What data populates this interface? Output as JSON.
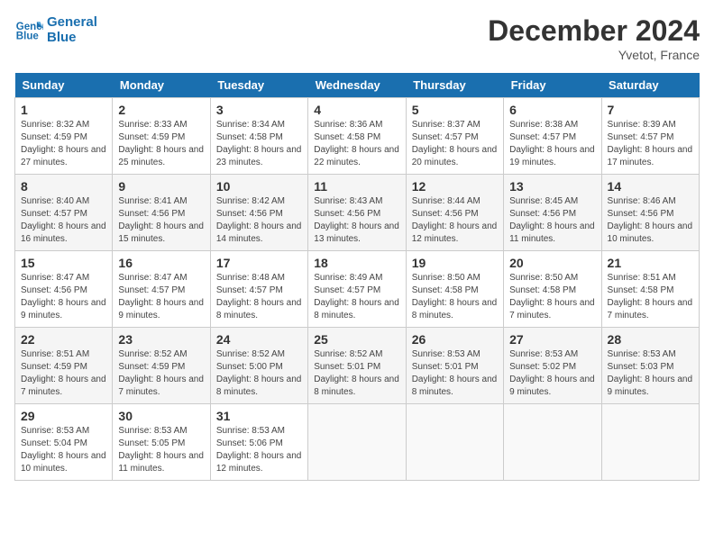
{
  "header": {
    "logo_line1": "General",
    "logo_line2": "Blue",
    "month_title": "December 2024",
    "location": "Yvetot, France"
  },
  "weekdays": [
    "Sunday",
    "Monday",
    "Tuesday",
    "Wednesday",
    "Thursday",
    "Friday",
    "Saturday"
  ],
  "weeks": [
    [
      {
        "day": 1,
        "sunrise": "8:32 AM",
        "sunset": "4:59 PM",
        "daylight": "8 hours and 27 minutes."
      },
      {
        "day": 2,
        "sunrise": "8:33 AM",
        "sunset": "4:59 PM",
        "daylight": "8 hours and 25 minutes."
      },
      {
        "day": 3,
        "sunrise": "8:34 AM",
        "sunset": "4:58 PM",
        "daylight": "8 hours and 23 minutes."
      },
      {
        "day": 4,
        "sunrise": "8:36 AM",
        "sunset": "4:58 PM",
        "daylight": "8 hours and 22 minutes."
      },
      {
        "day": 5,
        "sunrise": "8:37 AM",
        "sunset": "4:57 PM",
        "daylight": "8 hours and 20 minutes."
      },
      {
        "day": 6,
        "sunrise": "8:38 AM",
        "sunset": "4:57 PM",
        "daylight": "8 hours and 19 minutes."
      },
      {
        "day": 7,
        "sunrise": "8:39 AM",
        "sunset": "4:57 PM",
        "daylight": "8 hours and 17 minutes."
      }
    ],
    [
      {
        "day": 8,
        "sunrise": "8:40 AM",
        "sunset": "4:57 PM",
        "daylight": "8 hours and 16 minutes."
      },
      {
        "day": 9,
        "sunrise": "8:41 AM",
        "sunset": "4:56 PM",
        "daylight": "8 hours and 15 minutes."
      },
      {
        "day": 10,
        "sunrise": "8:42 AM",
        "sunset": "4:56 PM",
        "daylight": "8 hours and 14 minutes."
      },
      {
        "day": 11,
        "sunrise": "8:43 AM",
        "sunset": "4:56 PM",
        "daylight": "8 hours and 13 minutes."
      },
      {
        "day": 12,
        "sunrise": "8:44 AM",
        "sunset": "4:56 PM",
        "daylight": "8 hours and 12 minutes."
      },
      {
        "day": 13,
        "sunrise": "8:45 AM",
        "sunset": "4:56 PM",
        "daylight": "8 hours and 11 minutes."
      },
      {
        "day": 14,
        "sunrise": "8:46 AM",
        "sunset": "4:56 PM",
        "daylight": "8 hours and 10 minutes."
      }
    ],
    [
      {
        "day": 15,
        "sunrise": "8:47 AM",
        "sunset": "4:56 PM",
        "daylight": "8 hours and 9 minutes."
      },
      {
        "day": 16,
        "sunrise": "8:47 AM",
        "sunset": "4:57 PM",
        "daylight": "8 hours and 9 minutes."
      },
      {
        "day": 17,
        "sunrise": "8:48 AM",
        "sunset": "4:57 PM",
        "daylight": "8 hours and 8 minutes."
      },
      {
        "day": 18,
        "sunrise": "8:49 AM",
        "sunset": "4:57 PM",
        "daylight": "8 hours and 8 minutes."
      },
      {
        "day": 19,
        "sunrise": "8:50 AM",
        "sunset": "4:58 PM",
        "daylight": "8 hours and 8 minutes."
      },
      {
        "day": 20,
        "sunrise": "8:50 AM",
        "sunset": "4:58 PM",
        "daylight": "8 hours and 7 minutes."
      },
      {
        "day": 21,
        "sunrise": "8:51 AM",
        "sunset": "4:58 PM",
        "daylight": "8 hours and 7 minutes."
      }
    ],
    [
      {
        "day": 22,
        "sunrise": "8:51 AM",
        "sunset": "4:59 PM",
        "daylight": "8 hours and 7 minutes."
      },
      {
        "day": 23,
        "sunrise": "8:52 AM",
        "sunset": "4:59 PM",
        "daylight": "8 hours and 7 minutes."
      },
      {
        "day": 24,
        "sunrise": "8:52 AM",
        "sunset": "5:00 PM",
        "daylight": "8 hours and 8 minutes."
      },
      {
        "day": 25,
        "sunrise": "8:52 AM",
        "sunset": "5:01 PM",
        "daylight": "8 hours and 8 minutes."
      },
      {
        "day": 26,
        "sunrise": "8:53 AM",
        "sunset": "5:01 PM",
        "daylight": "8 hours and 8 minutes."
      },
      {
        "day": 27,
        "sunrise": "8:53 AM",
        "sunset": "5:02 PM",
        "daylight": "8 hours and 9 minutes."
      },
      {
        "day": 28,
        "sunrise": "8:53 AM",
        "sunset": "5:03 PM",
        "daylight": "8 hours and 9 minutes."
      }
    ],
    [
      {
        "day": 29,
        "sunrise": "8:53 AM",
        "sunset": "5:04 PM",
        "daylight": "8 hours and 10 minutes."
      },
      {
        "day": 30,
        "sunrise": "8:53 AM",
        "sunset": "5:05 PM",
        "daylight": "8 hours and 11 minutes."
      },
      {
        "day": 31,
        "sunrise": "8:53 AM",
        "sunset": "5:06 PM",
        "daylight": "8 hours and 12 minutes."
      },
      null,
      null,
      null,
      null
    ]
  ],
  "labels": {
    "sunrise": "Sunrise:",
    "sunset": "Sunset:",
    "daylight": "Daylight:"
  }
}
